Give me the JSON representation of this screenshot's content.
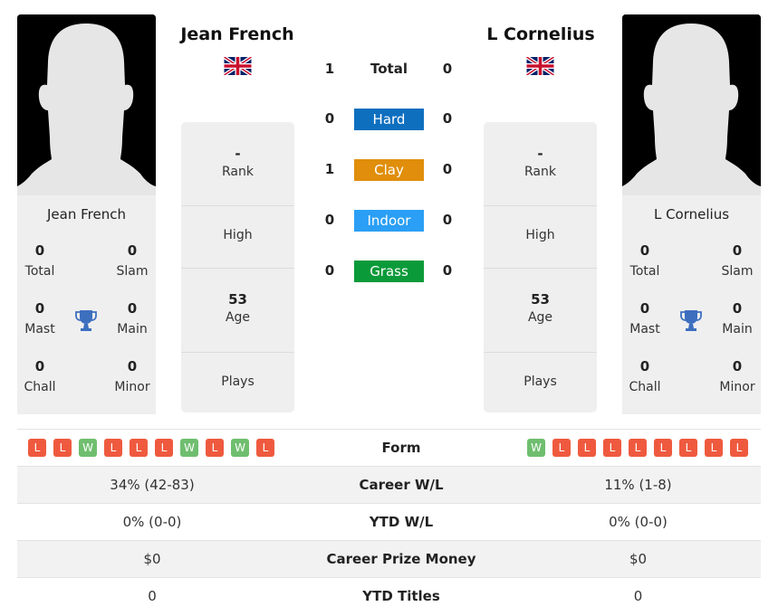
{
  "colors": {
    "hard": "#0e6fbf",
    "clay": "#e08e0b",
    "indoor": "#2b9ff5",
    "grass": "#0b9a3a",
    "loss": "#ef5a3f",
    "win": "#6fbe6f",
    "trophy": "#3d6fbf"
  },
  "player_left": {
    "name": "Jean French",
    "country_flag": "uk-flag-icon",
    "titles": {
      "total": {
        "value": "0",
        "label": "Total"
      },
      "slam": {
        "value": "0",
        "label": "Slam"
      },
      "mast": {
        "value": "0",
        "label": "Mast"
      },
      "main": {
        "value": "0",
        "label": "Main"
      },
      "chall": {
        "value": "0",
        "label": "Chall"
      },
      "minor": {
        "value": "0",
        "label": "Minor"
      }
    },
    "info": {
      "rank": {
        "value": "-",
        "label": "Rank"
      },
      "high": {
        "value": "",
        "label": "High"
      },
      "age": {
        "value": "53",
        "label": "Age"
      },
      "plays": {
        "value": "",
        "label": "Plays"
      }
    },
    "form": [
      "L",
      "L",
      "W",
      "L",
      "L",
      "L",
      "W",
      "L",
      "W",
      "L"
    ]
  },
  "player_right": {
    "name": "L Cornelius",
    "country_flag": "uk-flag-icon",
    "titles": {
      "total": {
        "value": "0",
        "label": "Total"
      },
      "slam": {
        "value": "0",
        "label": "Slam"
      },
      "mast": {
        "value": "0",
        "label": "Mast"
      },
      "main": {
        "value": "0",
        "label": "Main"
      },
      "chall": {
        "value": "0",
        "label": "Chall"
      },
      "minor": {
        "value": "0",
        "label": "Minor"
      }
    },
    "info": {
      "rank": {
        "value": "-",
        "label": "Rank"
      },
      "high": {
        "value": "",
        "label": "High"
      },
      "age": {
        "value": "53",
        "label": "Age"
      },
      "plays": {
        "value": "",
        "label": "Plays"
      }
    },
    "form": [
      "W",
      "L",
      "L",
      "L",
      "L",
      "L",
      "L",
      "L",
      "L"
    ]
  },
  "h2h": {
    "total": {
      "label": "Total",
      "left": "1",
      "right": "0"
    },
    "surfaces": [
      {
        "key": "hard",
        "label": "Hard",
        "left": "0",
        "right": "0"
      },
      {
        "key": "clay",
        "label": "Clay",
        "left": "1",
        "right": "0"
      },
      {
        "key": "indoor",
        "label": "Indoor",
        "left": "0",
        "right": "0"
      },
      {
        "key": "grass",
        "label": "Grass",
        "left": "0",
        "right": "0"
      }
    ]
  },
  "stats": {
    "form_label": "Form",
    "rows": [
      {
        "label": "Career W/L",
        "left": "34% (42-83)",
        "right": "11% (1-8)"
      },
      {
        "label": "YTD W/L",
        "left": "0% (0-0)",
        "right": "0% (0-0)"
      },
      {
        "label": "Career Prize Money",
        "left": "$0",
        "right": "$0"
      },
      {
        "label": "YTD Titles",
        "left": "0",
        "right": "0"
      }
    ]
  }
}
